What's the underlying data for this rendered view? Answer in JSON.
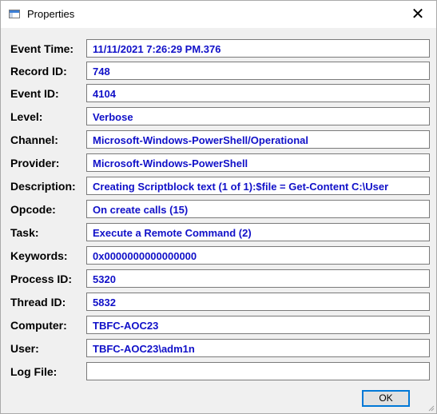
{
  "window": {
    "title": "Properties",
    "close_glyph": "✕",
    "icon": "window-properties-icon"
  },
  "fields": [
    {
      "key": "event_time",
      "label": "Event Time:",
      "value": "11/11/2021 7:26:29 PM.376"
    },
    {
      "key": "record_id",
      "label": "Record ID:",
      "value": "748"
    },
    {
      "key": "event_id",
      "label": "Event ID:",
      "value": "4104"
    },
    {
      "key": "level",
      "label": "Level:",
      "value": "Verbose"
    },
    {
      "key": "channel",
      "label": "Channel:",
      "value": "Microsoft-Windows-PowerShell/Operational"
    },
    {
      "key": "provider",
      "label": "Provider:",
      "value": "Microsoft-Windows-PowerShell"
    },
    {
      "key": "description",
      "label": "Description:",
      "value": "Creating Scriptblock text (1 of 1):$file = Get-Content C:\\User"
    },
    {
      "key": "opcode",
      "label": "Opcode:",
      "value": "On create calls (15)"
    },
    {
      "key": "task",
      "label": "Task:",
      "value": "Execute a Remote Command (2)"
    },
    {
      "key": "keywords",
      "label": "Keywords:",
      "value": "0x0000000000000000"
    },
    {
      "key": "process_id",
      "label": "Process ID:",
      "value": "5320"
    },
    {
      "key": "thread_id",
      "label": "Thread ID:",
      "value": "5832"
    },
    {
      "key": "computer",
      "label": "Computer:",
      "value": "TBFC-AOC23"
    },
    {
      "key": "user",
      "label": "User:",
      "value": "TBFC-AOC23\\adm1n"
    },
    {
      "key": "log_file",
      "label": "Log File:",
      "value": ""
    }
  ],
  "buttons": {
    "ok_label": "OK"
  },
  "colors": {
    "value_text": "#1010c8",
    "accent_border": "#0078d7",
    "dialog_background": "#f0f0f0"
  }
}
